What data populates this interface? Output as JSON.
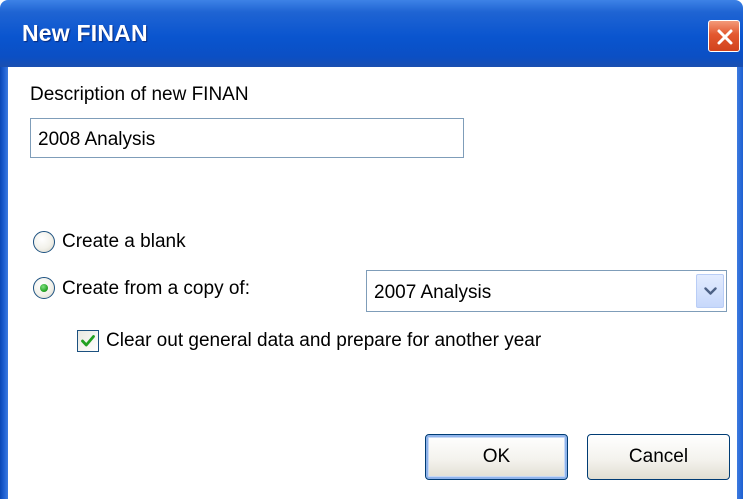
{
  "window": {
    "title": "New FINAN"
  },
  "description": {
    "label": "Description of new FINAN",
    "value": "2008 Analysis"
  },
  "options": {
    "blank_label": "Create a blank",
    "copy_label": "Create from a copy of:",
    "selected": "copy"
  },
  "copy_source": {
    "selected_value": "2007 Analysis"
  },
  "clear_out": {
    "label": "Clear out general data and prepare for another year",
    "checked": true
  },
  "buttons": {
    "ok_label": "OK",
    "cancel_label": "Cancel"
  },
  "colors": {
    "titlebar": "#0a55cf",
    "close_button": "#e3582f",
    "radio_dot": "#2aa82a",
    "checkmark": "#21a121"
  },
  "icons": {
    "close": "close-icon",
    "dropdown": "chevron-down-icon",
    "check": "checkmark-icon"
  }
}
